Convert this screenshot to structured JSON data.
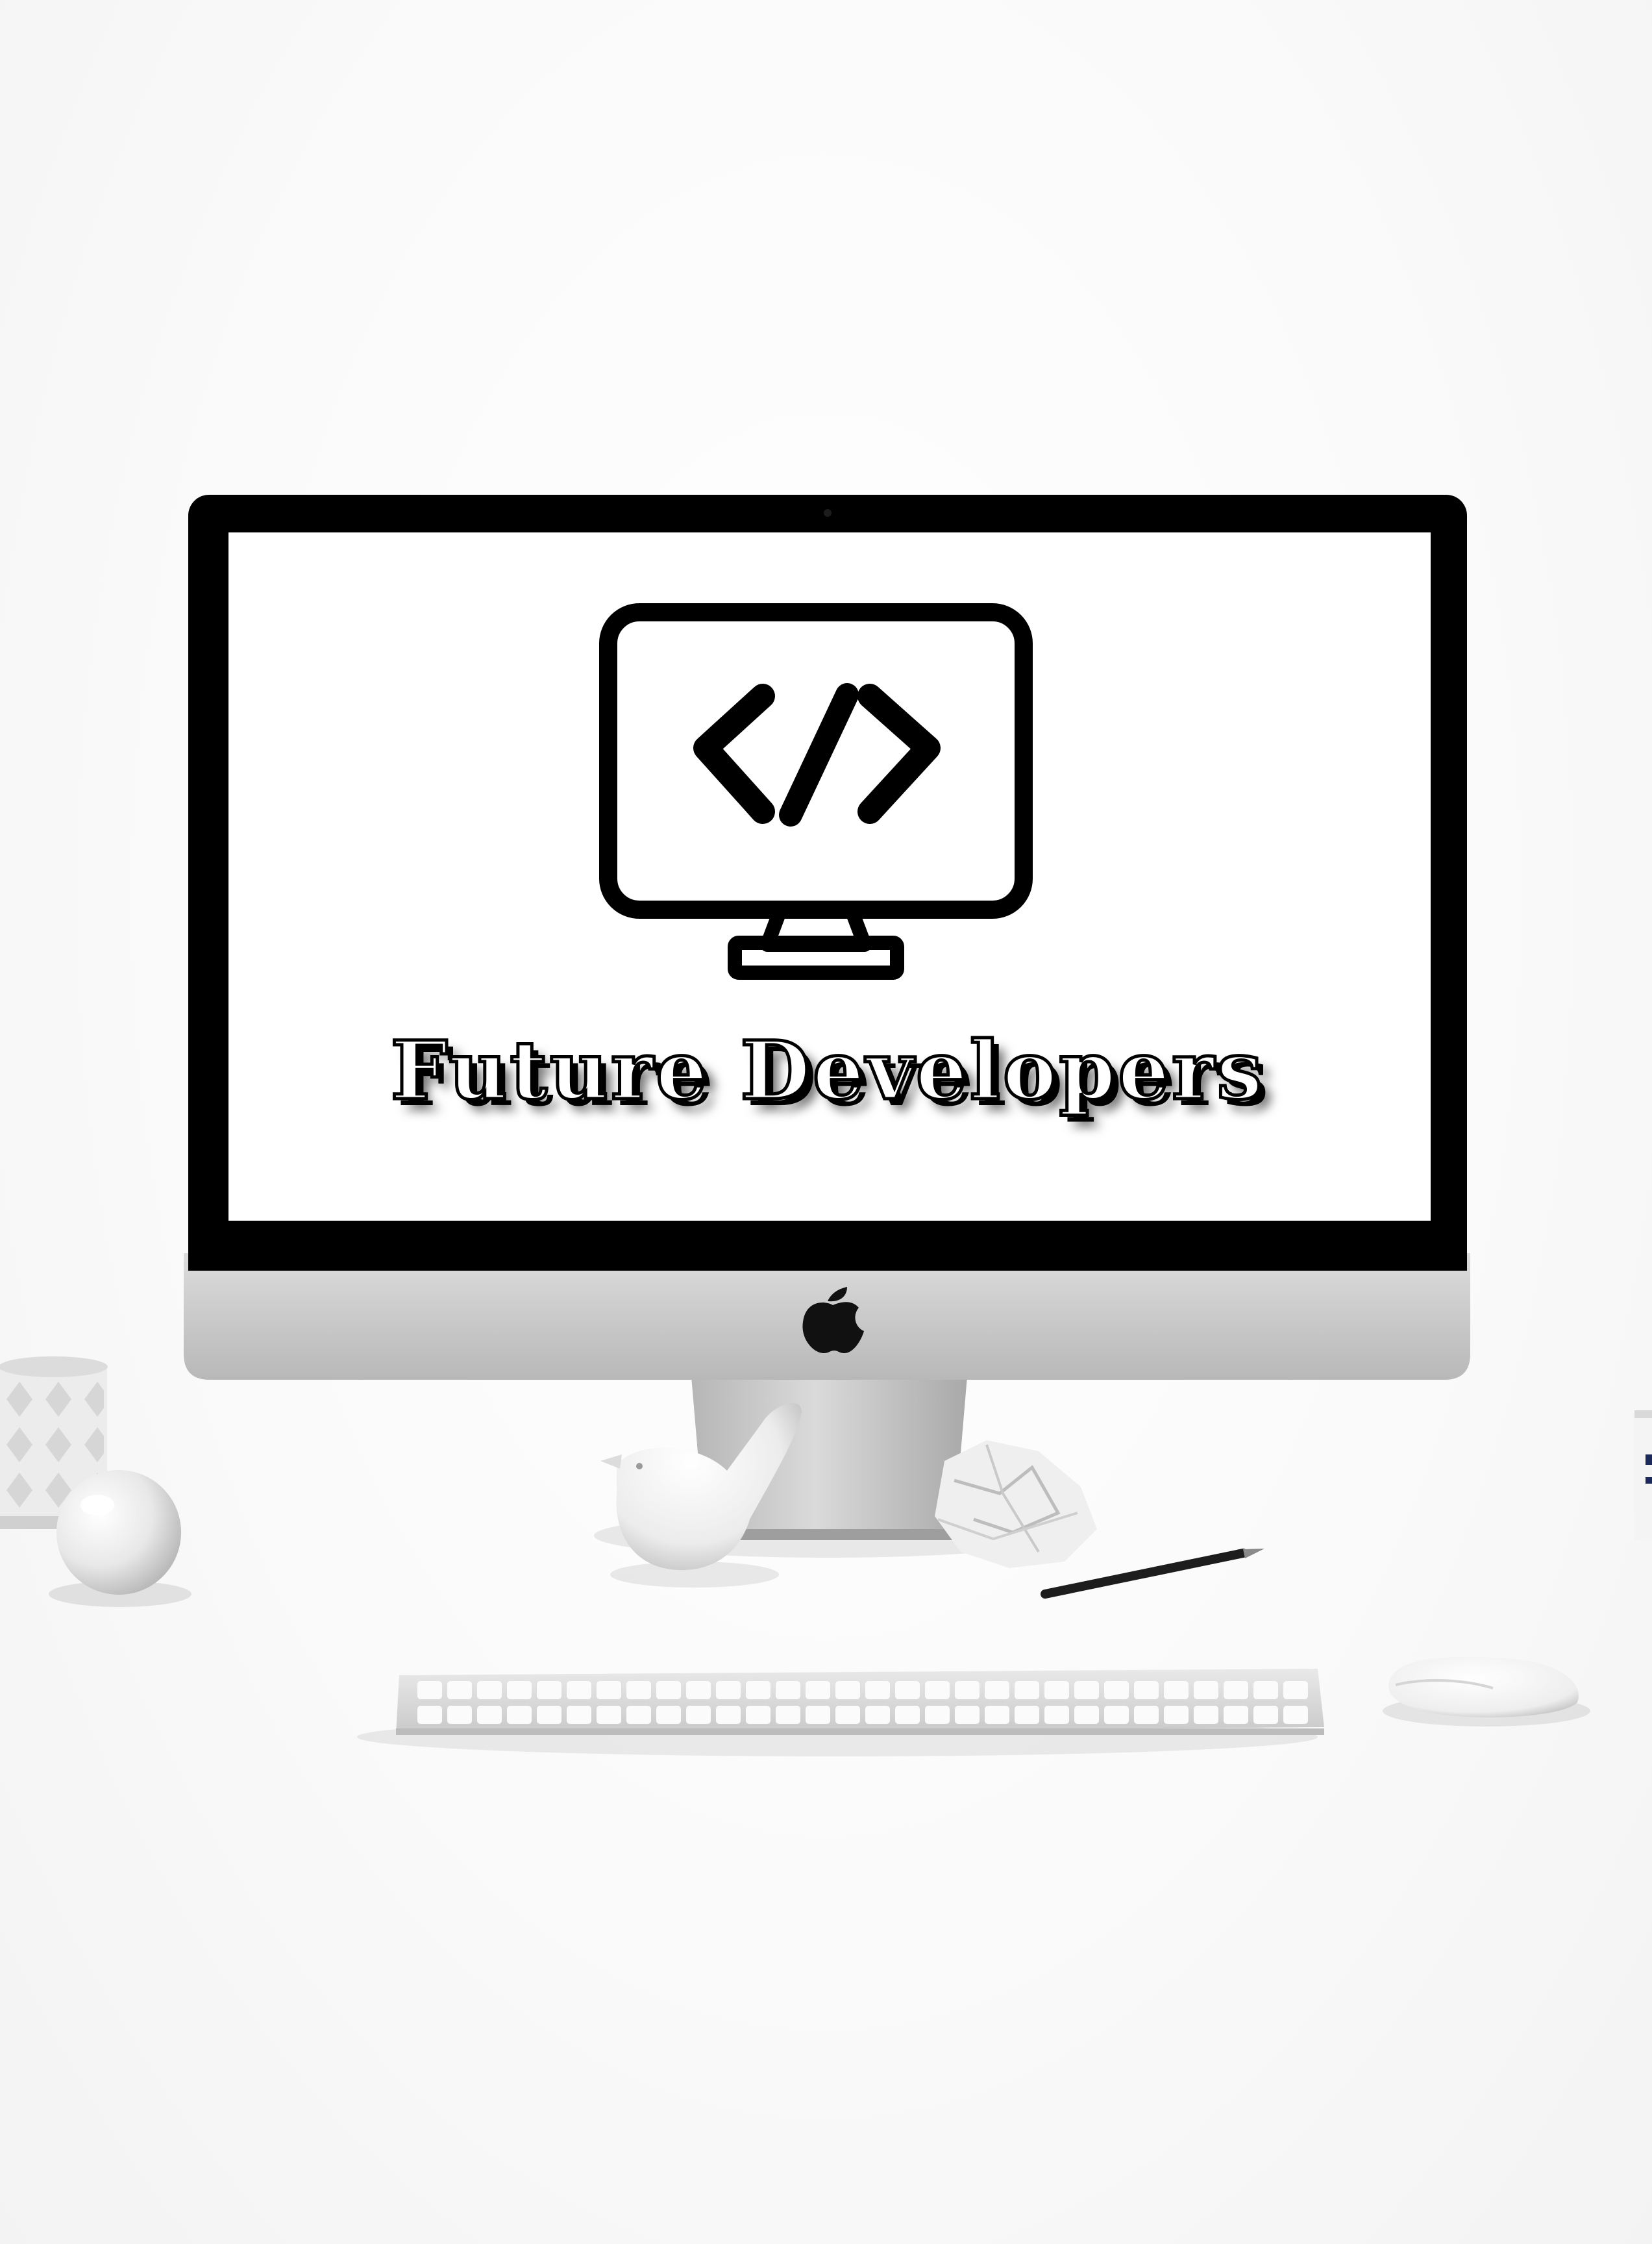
{
  "screen": {
    "tagline": "Future Developers",
    "logo_icon": "code-monitor-icon"
  },
  "imac": {
    "brand_icon": "apple-logo-icon"
  },
  "props": {
    "icons": [
      "vase-icon",
      "sphere-icon",
      "bird-figurine-icon",
      "crumpled-paper-icon",
      "pencil-icon",
      "keyboard-icon",
      "mouse-icon",
      "mug-icon"
    ]
  },
  "colors": {
    "screen_background": "#ffffff",
    "bezel": "#000000",
    "chin": "#c8c8c8",
    "desk": "#fafafa"
  }
}
